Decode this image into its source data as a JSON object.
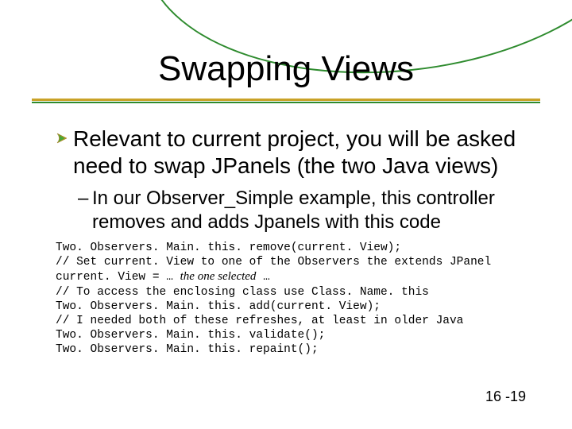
{
  "title": "Swapping Views",
  "bullet1": "Relevant to current project, you will be asked need to swap JPanels (the two Java views)",
  "sub1": "In our Observer_Simple example, this controller removes and adds Jpanels with this code",
  "code": {
    "l1": "Two. Observers. Main. this. remove(current. View);",
    "l2": "// Set current. View to one of the Observers the extends JPanel",
    "l3a": "current. View = … ",
    "l3b": "the one selected",
    "l3c": " …",
    "l4": "// To access the enclosing class use Class. Name. this",
    "l5": "Two. Observers. Main. this. add(current. View);",
    "l6": "// I needed both of these refreshes, at least in older Java",
    "l7": "Two. Observers. Main. this. validate();",
    "l8": "Two. Observers. Main. this. repaint();"
  },
  "page": "16 -19"
}
